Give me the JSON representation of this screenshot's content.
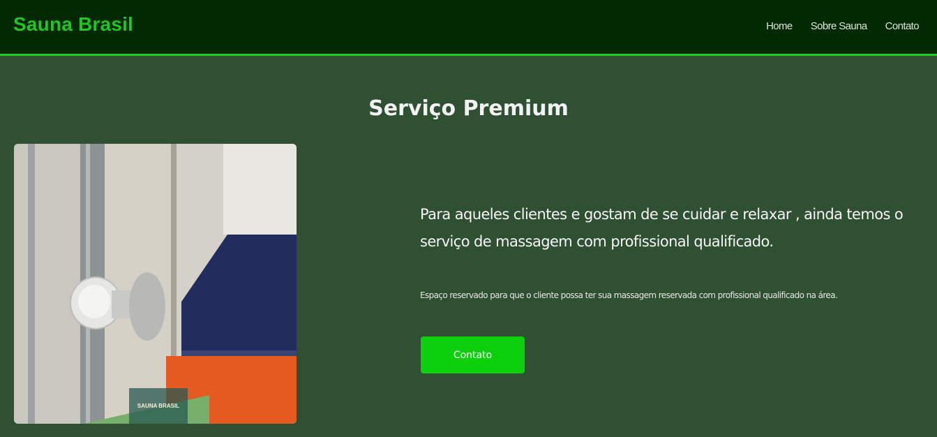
{
  "header": {
    "brand": "Sauna Brasil",
    "nav": [
      "Home",
      "Sobre Sauna",
      "Contato"
    ]
  },
  "main": {
    "title": "Serviço Premium",
    "headline": "Para aqueles clientes e gostam de se cuidar e relaxar , ainda temos o serviço de massagem com profissional qualificado.",
    "description": "Espaço reservado para que o cliente possa ter sua massagem reservada com profissional qualificado na área.",
    "cta_label": "Contato",
    "photo_logo_text": "SAUNA BRASIL"
  },
  "colors": {
    "page_background": "#2f5032",
    "header_background": "#032902",
    "brand_green": "#22c522",
    "button_green": "#0bd00b"
  }
}
